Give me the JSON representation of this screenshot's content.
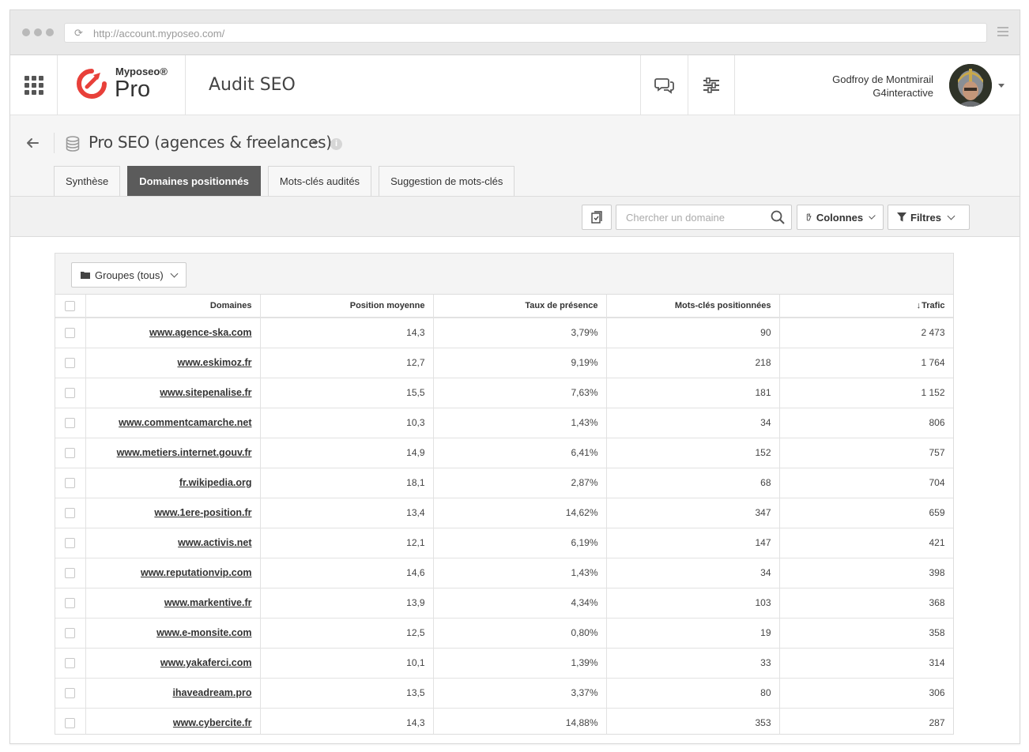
{
  "browser": {
    "url": "http://account.myposeo.com/"
  },
  "header": {
    "brand": "Myposeo®",
    "product": "Pro",
    "title": "Audit SEO",
    "user_name": "Godfroy de Montmirail",
    "user_org": "G4interactive"
  },
  "project": {
    "title": "Pro SEO (agences & freelances)",
    "tabs": [
      "Synthèse",
      "Domaines positionnés",
      "Mots-clés audités",
      "Suggestion de mots-clés"
    ],
    "active_tab": "Domaines positionnés"
  },
  "toolbar": {
    "search_placeholder": "Chercher un domaine",
    "columns_label": "Colonnes",
    "filters_label": "Filtres"
  },
  "panel": {
    "groups_label": "Groupes (tous)"
  },
  "table": {
    "headers": [
      "Domaines",
      "Position moyenne",
      "Taux de présence",
      "Mots-clés positionnées",
      "Trafic"
    ],
    "sort_arrow": "↓",
    "rows": [
      [
        "www.agence-ska.com",
        "14,3",
        "3,79%",
        "90",
        "2 473"
      ],
      [
        "www.eskimoz.fr",
        "12,7",
        "9,19%",
        "218",
        "1 764"
      ],
      [
        "www.sitepenalise.fr",
        "15,5",
        "7,63%",
        "181",
        "1 152"
      ],
      [
        "www.commentcamarche.net",
        "10,3",
        "1,43%",
        "34",
        "806"
      ],
      [
        "www.metiers.internet.gouv.fr",
        "14,9",
        "6,41%",
        "152",
        "757"
      ],
      [
        "fr.wikipedia.org",
        "18,1",
        "2,87%",
        "68",
        "704"
      ],
      [
        "www.1ere-position.fr",
        "13,4",
        "14,62%",
        "347",
        "659"
      ],
      [
        "www.activis.net",
        "12,1",
        "6,19%",
        "147",
        "421"
      ],
      [
        "www.reputationvip.com",
        "14,6",
        "1,43%",
        "34",
        "398"
      ],
      [
        "www.markentive.fr",
        "13,9",
        "4,34%",
        "103",
        "368"
      ],
      [
        "www.e-monsite.com",
        "12,5",
        "0,80%",
        "19",
        "358"
      ],
      [
        "www.yakaferci.com",
        "10,1",
        "1,39%",
        "33",
        "314"
      ],
      [
        "ihaveadream.pro",
        "13,5",
        "3,37%",
        "80",
        "306"
      ],
      [
        "www.cybercite.fr",
        "14,3",
        "14,88%",
        "353",
        "287"
      ]
    ]
  },
  "colors": {
    "brand_red": "#e8403a",
    "active_tab": "#5b5b5b"
  }
}
